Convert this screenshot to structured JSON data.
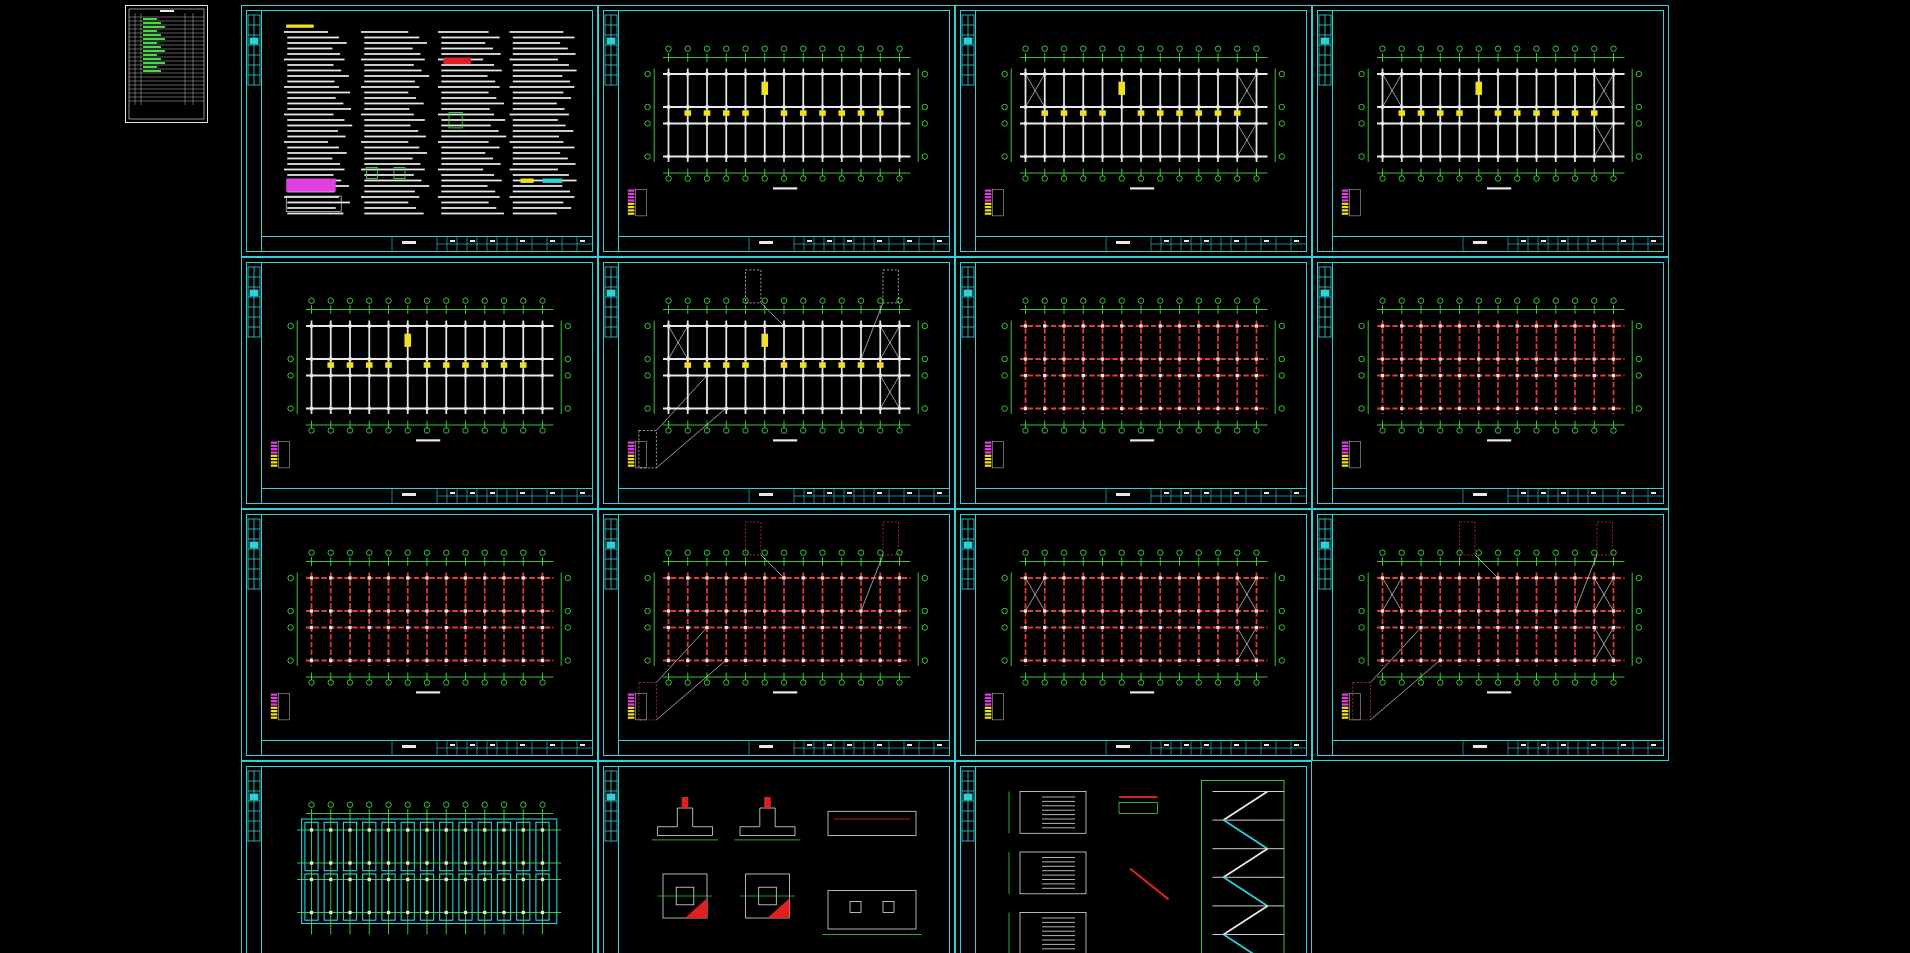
{
  "index_sheet": {
    "kind": "index"
  },
  "sheets": [
    {
      "kind": "notes"
    },
    {
      "kind": "plan",
      "color": "#e8e8e8",
      "tags": true,
      "bracing": false,
      "insets": false
    },
    {
      "kind": "plan",
      "color": "#e8e8e8",
      "tags": true,
      "bracing": true,
      "insets": false
    },
    {
      "kind": "plan",
      "color": "#e8e8e8",
      "tags": true,
      "bracing": true,
      "insets": false
    },
    {
      "kind": "plan",
      "color": "#e8e8e8",
      "tags": true,
      "bracing": false,
      "insets": false
    },
    {
      "kind": "plan",
      "color": "#e8e8e8",
      "tags": true,
      "bracing": true,
      "insets": true
    },
    {
      "kind": "plan",
      "color": "#e03a3a",
      "tags": false,
      "bracing": false,
      "insets": false
    },
    {
      "kind": "plan",
      "color": "#e03a3a",
      "tags": false,
      "bracing": false,
      "insets": false
    },
    {
      "kind": "plan",
      "color": "#e03a3a",
      "tags": false,
      "bracing": false,
      "insets": false
    },
    {
      "kind": "plan",
      "color": "#e03a3a",
      "tags": false,
      "bracing": false,
      "insets": true
    },
    {
      "kind": "plan",
      "color": "#e03a3a",
      "tags": false,
      "bracing": true,
      "insets": false
    },
    {
      "kind": "plan",
      "color": "#e03a3a",
      "tags": false,
      "bracing": true,
      "insets": true
    },
    {
      "kind": "foundation"
    },
    {
      "kind": "details"
    },
    {
      "kind": "stairs"
    }
  ]
}
